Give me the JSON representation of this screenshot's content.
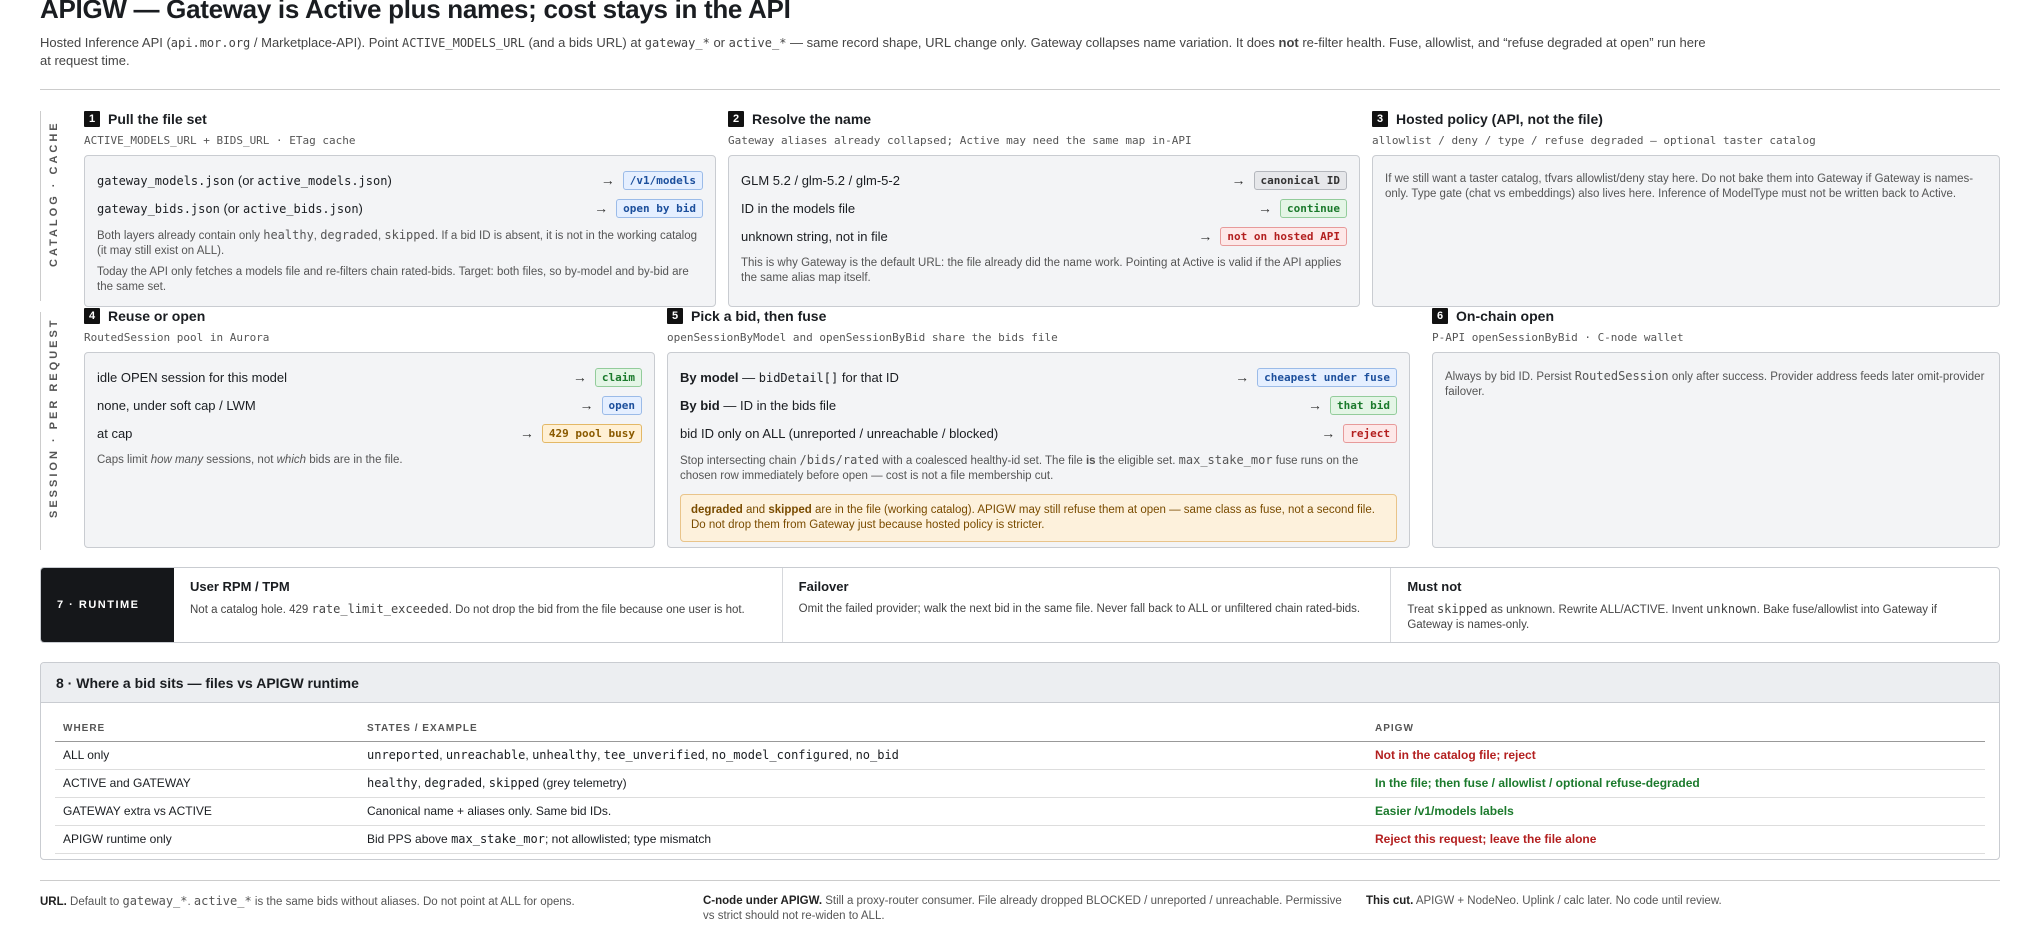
{
  "header": {
    "title": "APIGW — Gateway is Active plus names; cost stays in the API",
    "intro": [
      {
        "t": "Hosted Inference API ("
      },
      {
        "t": "api.mor.org",
        "m": 1
      },
      {
        "t": " / Marketplace-API). Point "
      },
      {
        "t": "ACTIVE_MODELS_URL",
        "m": 1
      },
      {
        "t": " (and a bids URL) at "
      },
      {
        "t": "gateway_*",
        "m": 1
      },
      {
        "t": " or "
      },
      {
        "t": "active_*",
        "m": 1
      },
      {
        "t": " — same record shape, URL change only. Gateway collapses name variation. It does "
      },
      {
        "t": "not",
        "b": 1
      },
      {
        "t": " re-filter health. Fuse, allowlist, and “refuse degraded at open” run here at request time."
      }
    ]
  },
  "rails": {
    "catalog": "CATALOG · CACHE",
    "session": "SESSION · PER REQUEST"
  },
  "steps": {
    "s1": {
      "num": "1",
      "title": "Pull the file set",
      "sub": "ACTIVE_MODELS_URL + BIDS_URL · ETag cache",
      "rows": [
        {
          "parts": [
            {
              "t": "gateway_models.json",
              "m": 1
            },
            {
              "t": " (or "
            },
            {
              "t": "active_models.json",
              "m": 1
            },
            {
              "t": ")"
            }
          ],
          "tag": "/v1/models",
          "cls": "t-blue"
        },
        {
          "parts": [
            {
              "t": "gateway_bids.json",
              "m": 1
            },
            {
              "t": " (or "
            },
            {
              "t": "active_bids.json",
              "m": 1
            },
            {
              "t": ")"
            }
          ],
          "tag": "open by bid",
          "cls": "t-blue"
        }
      ],
      "notes": [
        [
          {
            "t": "Both layers already contain only "
          },
          {
            "t": "healthy",
            "m": 1
          },
          {
            "t": ", "
          },
          {
            "t": "degraded",
            "m": 1
          },
          {
            "t": ", "
          },
          {
            "t": "skipped",
            "m": 1
          },
          {
            "t": ". If a bid ID is absent, it is not in the working catalog (it may still exist on ALL)."
          }
        ],
        [
          {
            "t": "Today the API only fetches a models file and re-filters chain rated-bids. Target: both files, so by-model and by-bid are the same set."
          }
        ]
      ]
    },
    "s2": {
      "num": "2",
      "title": "Resolve the name",
      "sub": "Gateway aliases already collapsed; Active may need the same map in-API",
      "rows": [
        {
          "parts": [
            {
              "t": "GLM 5.2 / glm-5.2 / glm-5-2"
            }
          ],
          "tag": "canonical ID",
          "cls": "t-gray"
        },
        {
          "parts": [
            {
              "t": "ID in the models file"
            }
          ],
          "tag": "continue",
          "cls": "t-green"
        },
        {
          "parts": [
            {
              "t": "unknown string, not in file"
            }
          ],
          "tag": "not on hosted API",
          "cls": "t-red"
        }
      ],
      "notes": [
        [
          {
            "t": "This is why Gateway is the default URL: the file already did the name work. Pointing at Active is valid if the API applies the same alias map itself."
          }
        ]
      ]
    },
    "s3": {
      "num": "3",
      "title": "Hosted policy (API, not the file)",
      "sub": "allowlist / deny / type / refuse degraded — optional taster catalog",
      "rows": [],
      "notes": [
        [
          {
            "t": "If we still want a taster catalog, tfvars allowlist/deny stay here. Do not bake them into Gateway if Gateway is names-only. Type gate (chat vs embeddings) also lives here. Inference of ModelType must not be written back to Active."
          }
        ]
      ]
    },
    "s4": {
      "num": "4",
      "title": "Reuse or open",
      "sub": "RoutedSession pool in Aurora",
      "rows": [
        {
          "parts": [
            {
              "t": "idle OPEN session for this model"
            }
          ],
          "tag": "claim",
          "cls": "t-green"
        },
        {
          "parts": [
            {
              "t": "none, under soft cap / LWM"
            }
          ],
          "tag": "open",
          "cls": "t-blue"
        },
        {
          "parts": [
            {
              "t": "at cap"
            }
          ],
          "tag": "429 pool busy",
          "cls": "t-amber"
        }
      ],
      "notes": [
        [
          {
            "t": "Caps limit "
          },
          {
            "t": "how many",
            "i": 1
          },
          {
            "t": " sessions, not "
          },
          {
            "t": "which",
            "i": 1
          },
          {
            "t": " bids are in the file."
          }
        ]
      ]
    },
    "s5": {
      "num": "5",
      "title": "Pick a bid, then fuse",
      "sub": "openSessionByModel and openSessionByBid share the bids file",
      "rows": [
        {
          "parts": [
            {
              "t": "By model",
              "b": 1
            },
            {
              "t": " — "
            },
            {
              "t": "bidDetail[]",
              "m": 1
            },
            {
              "t": " for that ID"
            }
          ],
          "tag": "cheapest under fuse",
          "cls": "t-blue"
        },
        {
          "parts": [
            {
              "t": "By bid",
              "b": 1
            },
            {
              "t": " — ID in the bids file"
            }
          ],
          "tag": "that bid",
          "cls": "t-green"
        },
        {
          "parts": [
            {
              "t": "bid ID only on ALL (unreported / unreachable / blocked)"
            }
          ],
          "tag": "reject",
          "cls": "t-red"
        }
      ],
      "notes": [
        [
          {
            "t": "Stop intersecting chain "
          },
          {
            "t": "/bids/rated",
            "m": 1
          },
          {
            "t": " with a coalesced healthy-id set. The file "
          },
          {
            "t": "is",
            "b": 1
          },
          {
            "t": " the eligible set. "
          },
          {
            "t": "max_stake_mor",
            "m": 1
          },
          {
            "t": " fuse runs on the chosen row immediately before open — cost is not a file membership cut."
          }
        ]
      ],
      "warn": [
        {
          "t": "degraded",
          "b": 1
        },
        {
          "t": " and "
        },
        {
          "t": "skipped",
          "b": 1
        },
        {
          "t": " are in the file (working catalog). APIGW may still refuse them at open — same class as fuse, not a second file. Do not drop them from Gateway just because hosted policy is stricter."
        }
      ]
    },
    "s6": {
      "num": "6",
      "title": "On-chain open",
      "sub": "P-API openSessionByBid · C-node wallet",
      "rows": [],
      "notes": [
        [
          {
            "t": "Always by bid ID. Persist "
          },
          {
            "t": "RoutedSession",
            "m": 1
          },
          {
            "t": " only after success. Provider address feeds later omit-provider failover."
          }
        ]
      ]
    }
  },
  "runtime": {
    "label": "7 · RUNTIME",
    "cols": [
      {
        "title": "User RPM / TPM",
        "parts": [
          {
            "t": "Not a catalog hole. 429 "
          },
          {
            "t": "rate_limit_exceeded",
            "m": 1
          },
          {
            "t": ". Do not drop the bid from the file because one user is hot."
          }
        ]
      },
      {
        "title": "Failover",
        "parts": [
          {
            "t": "Omit the failed provider; walk the next bid in the same file. Never fall back to ALL or unfiltered chain rated-bids."
          }
        ]
      },
      {
        "title": "Must not",
        "parts": [
          {
            "t": "Treat "
          },
          {
            "t": "skipped",
            "m": 1
          },
          {
            "t": " as unknown. Rewrite ALL/ACTIVE. Invent "
          },
          {
            "t": "unknown",
            "m": 1
          },
          {
            "t": ". Bake fuse/allowlist into Gateway if Gateway is names-only."
          }
        ]
      }
    ]
  },
  "table": {
    "title": "8 · Where a bid sits — files vs APIGW runtime",
    "headers": [
      "WHERE",
      "STATES / EXAMPLE",
      "APIGW"
    ],
    "rows": [
      {
        "where": "ALL only",
        "states": [
          {
            "t": "unreported",
            "m": 1
          },
          {
            "t": ", "
          },
          {
            "t": "unreachable",
            "m": 1
          },
          {
            "t": ", "
          },
          {
            "t": "unhealthy",
            "m": 1
          },
          {
            "t": ", "
          },
          {
            "t": "tee_unverified",
            "m": 1
          },
          {
            "t": ", "
          },
          {
            "t": "no_model_configured",
            "m": 1
          },
          {
            "t": ", "
          },
          {
            "t": "no_bid",
            "m": 1
          }
        ],
        "apigw": "Not in the catalog file; reject",
        "cls": "red"
      },
      {
        "where": "ACTIVE and GATEWAY",
        "states": [
          {
            "t": "healthy",
            "m": 1
          },
          {
            "t": ", "
          },
          {
            "t": "degraded",
            "m": 1
          },
          {
            "t": ", "
          },
          {
            "t": "skipped",
            "m": 1
          },
          {
            "t": " (grey telemetry)"
          }
        ],
        "apigw": "In the file; then fuse / allowlist / optional refuse-degraded",
        "cls": "green"
      },
      {
        "where": "GATEWAY extra vs ACTIVE",
        "states": [
          {
            "t": "Canonical name + aliases only. Same bid IDs."
          }
        ],
        "apigw": "Easier /v1/models labels",
        "cls": "green"
      },
      {
        "where": "APIGW runtime only",
        "states": [
          {
            "t": "Bid PPS above "
          },
          {
            "t": "max_stake_mor",
            "m": 1
          },
          {
            "t": "; not allowlisted; type mismatch"
          }
        ],
        "apigw": "Reject this request; leave the file alone",
        "cls": "red"
      }
    ]
  },
  "footer": [
    {
      "bold": "URL.",
      "parts": [
        {
          "t": " Default to "
        },
        {
          "t": "gateway_*",
          "m": 1
        },
        {
          "t": ". "
        },
        {
          "t": "active_*",
          "m": 1
        },
        {
          "t": " is the same bids without aliases. Do not point at ALL for opens."
        }
      ]
    },
    {
      "bold": "C-node under APIGW.",
      "parts": [
        {
          "t": " Still a proxy-router consumer. File already dropped BLOCKED / unreported / unreachable. Permissive vs strict should not re-widen to ALL."
        }
      ]
    },
    {
      "bold": "This cut.",
      "parts": [
        {
          "t": " APIGW + NodeNeo. Uplink / calc later. No code until review."
        }
      ]
    }
  ]
}
